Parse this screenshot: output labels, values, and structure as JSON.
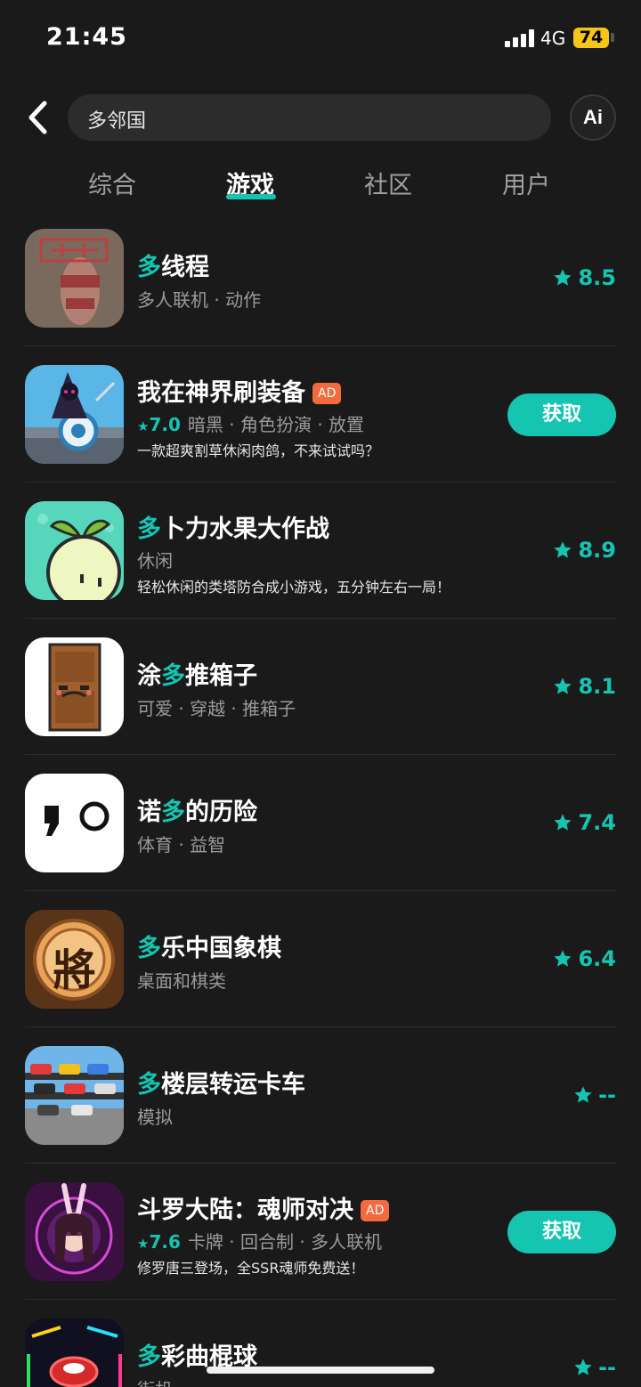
{
  "status_bar": {
    "time": "21:45",
    "network": "4G",
    "battery": "74"
  },
  "search": {
    "query": "多邻国"
  },
  "ai_button": {
    "label": "Ai"
  },
  "tabs": [
    {
      "label": "综合",
      "active": false
    },
    {
      "label": "游戏",
      "active": true
    },
    {
      "label": "社区",
      "active": false
    },
    {
      "label": "用户",
      "active": false
    }
  ],
  "apps": [
    {
      "name_hl": "多",
      "name_rest": "线程",
      "ad": "",
      "tags": "多人联机 · 动作",
      "score": "",
      "desc": "",
      "rating": "8.5",
      "action": ""
    },
    {
      "name_hl": "",
      "name_rest": "我在神界刷装备",
      "ad": "AD",
      "tags": "暗黑 · 角色扮演 · 放置",
      "score": "7.0",
      "desc": "一款超爽割草休闲肉鸽，不来试试吗？",
      "rating": "",
      "action": "获取"
    },
    {
      "name_hl": "多",
      "name_rest": "卜力水果大作战",
      "ad": "",
      "tags": "休闲",
      "score": "",
      "desc": "轻松休闲的类塔防合成小游戏，五分钟左右一局！",
      "rating": "8.9",
      "action": ""
    },
    {
      "name_pre": "涂",
      "name_hl": "多",
      "name_rest": "推箱子",
      "ad": "",
      "tags": "可爱 · 穿越 · 推箱子",
      "score": "",
      "desc": "",
      "rating": "8.1",
      "action": ""
    },
    {
      "name_pre": "诺",
      "name_hl": "多",
      "name_rest": "的历险",
      "ad": "",
      "tags": "体育 · 益智",
      "score": "",
      "desc": "",
      "rating": "7.4",
      "action": ""
    },
    {
      "name_hl": "多",
      "name_rest": "乐中国象棋",
      "ad": "",
      "tags": "桌面和棋类",
      "score": "",
      "desc": "",
      "rating": "6.4",
      "action": "",
      "icon_text": "將"
    },
    {
      "name_hl": "多",
      "name_rest": "楼层转运卡车",
      "ad": "",
      "tags": "模拟",
      "score": "",
      "desc": "",
      "rating": "--",
      "action": ""
    },
    {
      "name_hl": "",
      "name_rest": "斗罗大陆：魂师对决",
      "ad": "AD",
      "tags": "卡牌 · 回合制 · 多人联机",
      "score": "7.6",
      "desc": "修罗唐三登场，全SSR魂师免费送！",
      "rating": "",
      "action": "获取"
    },
    {
      "name_hl": "多",
      "name_rest": "彩曲棍球",
      "ad": "",
      "tags": "街机",
      "score": "",
      "desc": "",
      "rating": "--",
      "action": ""
    }
  ],
  "colors": {
    "accent": "#15c5b1",
    "background": "#1a1a1a",
    "ad": "#f26a3d"
  }
}
